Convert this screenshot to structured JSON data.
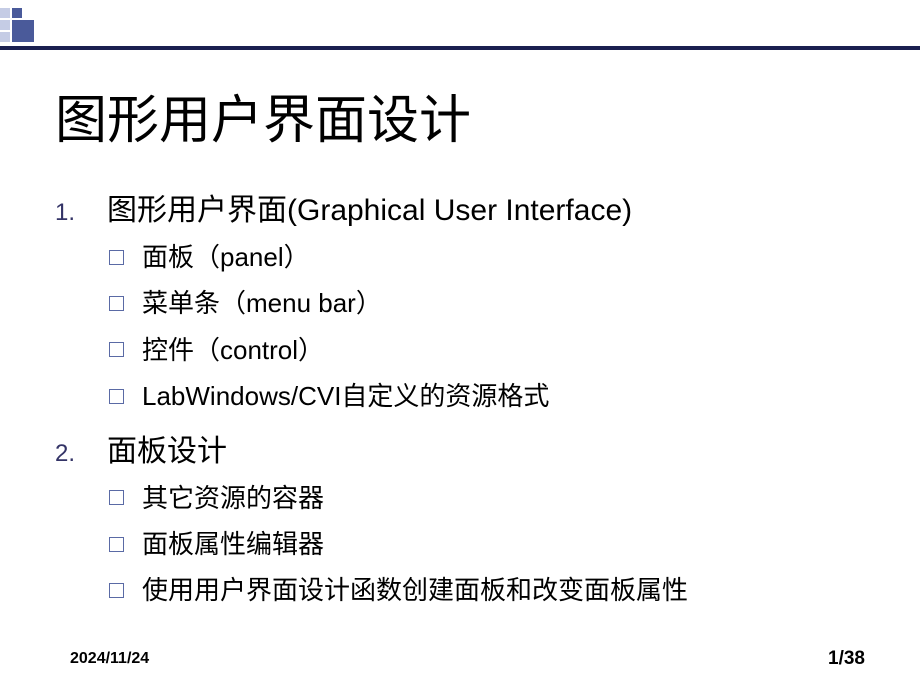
{
  "title": "图形用户界面设计",
  "items": [
    {
      "number": "1.",
      "text": "图形用户界面(Graphical User Interface)",
      "subitems": [
        "面板（panel）",
        "菜单条（menu bar）",
        "控件（control）",
        "LabWindows/CVI自定义的资源格式"
      ]
    },
    {
      "number": "2.",
      "text": "面板设计",
      "subitems": [
        "其它资源的容器",
        "面板属性编辑器",
        "使用用户界面设计函数创建面板和改变面板属性"
      ]
    }
  ],
  "footer": {
    "date": "2024/11/24",
    "page": "1/38"
  }
}
